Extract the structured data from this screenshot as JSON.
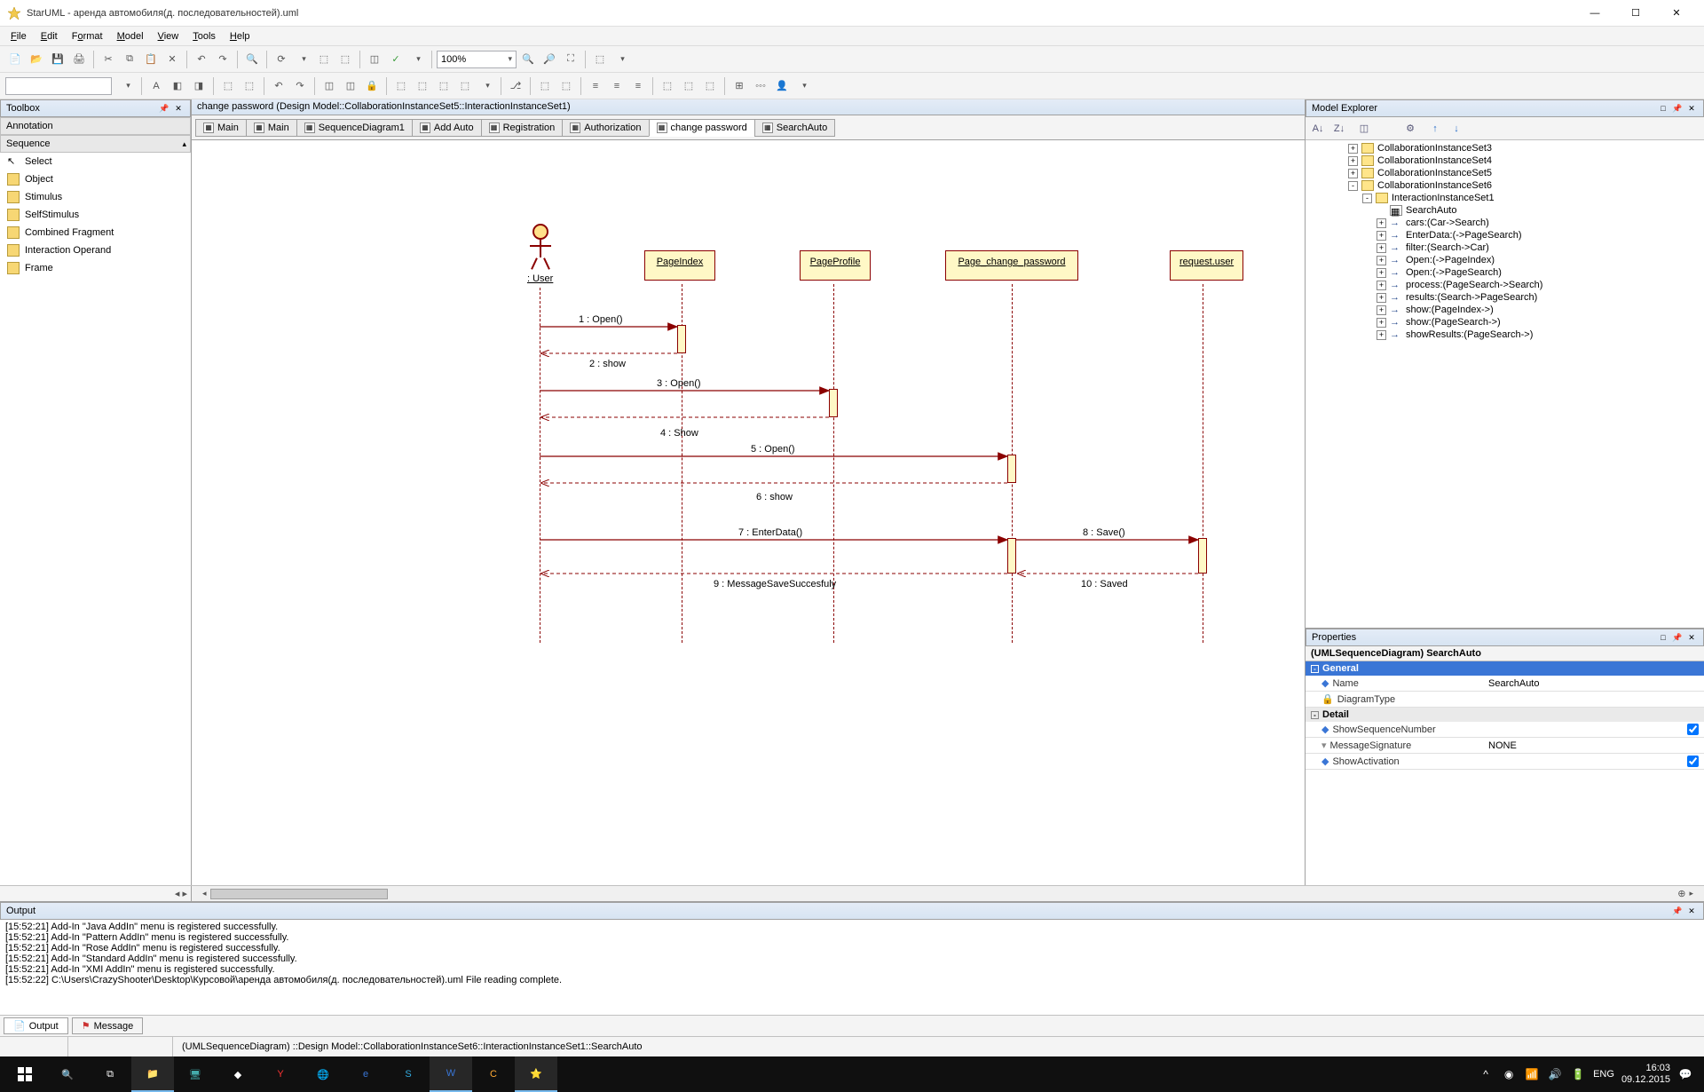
{
  "titlebar": {
    "text": "StarUML - аренда автомобиля(д. последовательностей).uml"
  },
  "menubar": [
    "File",
    "Edit",
    "Format",
    "Model",
    "View",
    "Tools",
    "Help"
  ],
  "toolbar": {
    "zoom": "100%"
  },
  "toolbox": {
    "panel_title": "Toolbox",
    "annotation_header": "Annotation",
    "sequence_header": "Sequence",
    "items": [
      "Select",
      "Object",
      "Stimulus",
      "SelfStimulus",
      "Combined Fragment",
      "Interaction Operand",
      "Frame"
    ]
  },
  "diagram": {
    "title_strip": "change password (Design Model::CollaborationInstanceSet5::InteractionInstanceSet1)",
    "tabs": [
      "Main",
      "Main",
      "SequenceDiagram1",
      "Add Auto",
      "Registration",
      "Authorization",
      "change password",
      "SearchAuto"
    ],
    "actor_label": ": User",
    "lifelines": [
      "PageIndex",
      "PageProfile",
      "Page_change_password",
      "request.user"
    ],
    "messages": [
      "1 : Open()",
      "2 : show",
      "3 : Open()",
      "4 : Show",
      "5 : Open()",
      "6 : show",
      "7 : EnterData()",
      "8 : Save()",
      "9 : MessageSaveSuccesfuly",
      "10 : Saved"
    ]
  },
  "explorer": {
    "panel_title": "Model Explorer",
    "nodes": [
      {
        "indent": 3,
        "toggle": "+",
        "icon": "pkg",
        "label": "CollaborationInstanceSet3"
      },
      {
        "indent": 3,
        "toggle": "+",
        "icon": "pkg",
        "label": "CollaborationInstanceSet4"
      },
      {
        "indent": 3,
        "toggle": "+",
        "icon": "pkg",
        "label": "CollaborationInstanceSet5"
      },
      {
        "indent": 3,
        "toggle": "-",
        "icon": "pkg",
        "label": "CollaborationInstanceSet6"
      },
      {
        "indent": 4,
        "toggle": "-",
        "icon": "pkg",
        "label": "InteractionInstanceSet1"
      },
      {
        "indent": 5,
        "toggle": "",
        "icon": "diag",
        "label": "SearchAuto"
      },
      {
        "indent": 5,
        "toggle": "+",
        "icon": "msg",
        "label": "cars:(Car->Search)"
      },
      {
        "indent": 5,
        "toggle": "+",
        "icon": "msg",
        "label": "EnterData:(->PageSearch)"
      },
      {
        "indent": 5,
        "toggle": "+",
        "icon": "msg",
        "label": "filter:(Search->Car)"
      },
      {
        "indent": 5,
        "toggle": "+",
        "icon": "msg",
        "label": "Open:(->PageIndex)"
      },
      {
        "indent": 5,
        "toggle": "+",
        "icon": "msg",
        "label": "Open:(->PageSearch)"
      },
      {
        "indent": 5,
        "toggle": "+",
        "icon": "msg",
        "label": "process:(PageSearch->Search)"
      },
      {
        "indent": 5,
        "toggle": "+",
        "icon": "msg",
        "label": "results:(Search->PageSearch)"
      },
      {
        "indent": 5,
        "toggle": "+",
        "icon": "msg",
        "label": "show:(PageIndex->)"
      },
      {
        "indent": 5,
        "toggle": "+",
        "icon": "msg",
        "label": "show:(PageSearch->)"
      },
      {
        "indent": 5,
        "toggle": "+",
        "icon": "msg",
        "label": "showResults:(PageSearch->)"
      }
    ]
  },
  "properties": {
    "panel_title": "Properties",
    "object_title": "(UMLSequenceDiagram) SearchAuto",
    "cat_general": "General",
    "row_name_key": "Name",
    "row_name_val": "SearchAuto",
    "row_diagtype_key": "DiagramType",
    "row_diagtype_val": "",
    "cat_detail": "Detail",
    "row_showseq_key": "ShowSequenceNumber",
    "row_msgsig_key": "MessageSignature",
    "row_msgsig_val": "NONE",
    "row_showact_key": "ShowActivation"
  },
  "output": {
    "panel_title": "Output",
    "lines": [
      "[15:52:21]  Add-In \"Java AddIn\" menu is registered successfully.",
      "[15:52:21]  Add-In \"Pattern AddIn\" menu is registered successfully.",
      "[15:52:21]  Add-In \"Rose AddIn\" menu is registered successfully.",
      "[15:52:21]  Add-In \"Standard AddIn\" menu is registered successfully.",
      "[15:52:21]  Add-In \"XMI AddIn\" menu is registered successfully.",
      "[15:52:22]  C:\\Users\\CrazyShooter\\Desktop\\Курсовой\\аренда автомобиля(д. последовательностей).uml File reading complete."
    ],
    "tab_output": "Output",
    "tab_message": "Message"
  },
  "statusbar": {
    "path": "(UMLSequenceDiagram) ::Design Model::CollaborationInstanceSet6::InteractionInstanceSet1::SearchAuto"
  },
  "taskbar": {
    "lang": "ENG",
    "time": "16:03",
    "date": "09.12.2015"
  }
}
